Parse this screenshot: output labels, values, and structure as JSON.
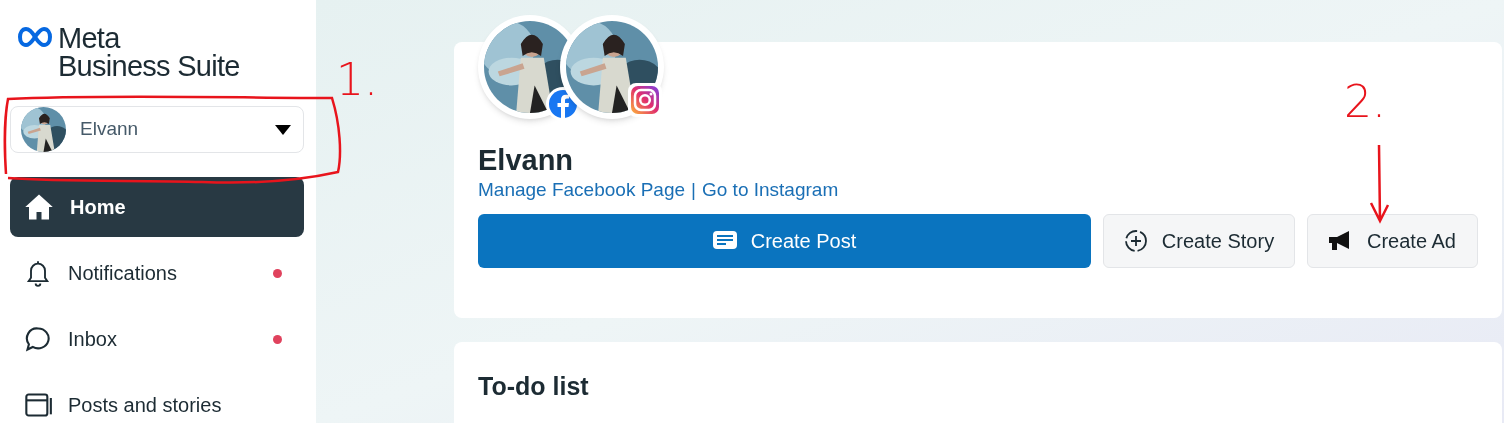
{
  "logo": {
    "line_1": "Meta",
    "line_2": "Business Suite"
  },
  "account_switcher": {
    "name": "Elvann"
  },
  "nav": [
    {
      "label": "Home",
      "kind": "home",
      "selected": true,
      "badge": false
    },
    {
      "label": "Notifications",
      "kind": "bell",
      "selected": false,
      "badge": true
    },
    {
      "label": "Inbox",
      "kind": "chat",
      "selected": false,
      "badge": true
    },
    {
      "label": "Posts and stories",
      "kind": "posts",
      "selected": false,
      "badge": false
    }
  ],
  "profile": {
    "name": "Elvann",
    "links": [
      "Manage Facebook Page",
      "Go to Instagram"
    ],
    "separator": "|",
    "accounts": [
      {
        "kind": "facebook"
      },
      {
        "kind": "instagram"
      }
    ],
    "actions": [
      {
        "label": "Create Post",
        "kind": "post",
        "primary": true
      },
      {
        "label": "Create Story",
        "kind": "story",
        "primary": false
      },
      {
        "label": "Create Ad",
        "kind": "ad",
        "primary": false
      }
    ]
  },
  "todo": {
    "title": "To-do list"
  },
  "annotations": [
    {
      "label": "1.",
      "kind": "loop"
    },
    {
      "label": "2.",
      "kind": "arrow"
    }
  ]
}
